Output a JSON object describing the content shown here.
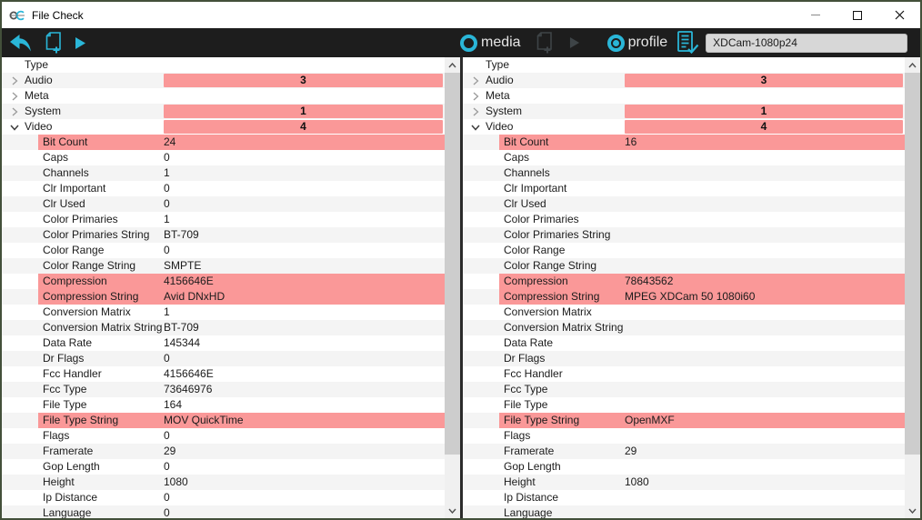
{
  "window": {
    "title": "File Check"
  },
  "toolbar": {
    "media_label": "media",
    "profile_label": "profile",
    "profile_name": "XDCam-1080p24"
  },
  "colors": {
    "accent_teal": "#2ab6d8",
    "highlight_pink": "#fa9898",
    "alt_row": "#f4f4f4",
    "toolbar_bg": "#1d1d1d"
  },
  "tree": {
    "header": "Type",
    "rows": [
      {
        "label": "Audio",
        "indent": 0,
        "expander": "collapsed",
        "left": {
          "badge": "3"
        },
        "right": {
          "badge": "3"
        }
      },
      {
        "label": "Meta",
        "indent": 0,
        "expander": "collapsed",
        "left": {},
        "right": {}
      },
      {
        "label": "System",
        "indent": 0,
        "expander": "collapsed",
        "left": {
          "badge": "1"
        },
        "right": {
          "badge": "1"
        }
      },
      {
        "label": "Video",
        "indent": 0,
        "expander": "expanded",
        "left": {
          "badge": "4"
        },
        "right": {
          "badge": "4"
        }
      },
      {
        "label": "Bit Count",
        "indent": 1,
        "left": {
          "value": "24",
          "highlight": true
        },
        "right": {
          "value": "16",
          "highlight": true
        }
      },
      {
        "label": "Caps",
        "indent": 1,
        "left": {
          "value": "0"
        },
        "right": {}
      },
      {
        "label": "Channels",
        "indent": 1,
        "left": {
          "value": "1"
        },
        "right": {}
      },
      {
        "label": "Clr Important",
        "indent": 1,
        "left": {
          "value": "0"
        },
        "right": {}
      },
      {
        "label": "Clr Used",
        "indent": 1,
        "left": {
          "value": "0"
        },
        "right": {}
      },
      {
        "label": "Color Primaries",
        "indent": 1,
        "left": {
          "value": "1"
        },
        "right": {}
      },
      {
        "label": "Color Primaries String",
        "indent": 1,
        "left": {
          "value": "BT-709"
        },
        "right": {}
      },
      {
        "label": "Color Range",
        "indent": 1,
        "left": {
          "value": "0"
        },
        "right": {}
      },
      {
        "label": "Color Range String",
        "indent": 1,
        "left": {
          "value": "SMPTE"
        },
        "right": {}
      },
      {
        "label": "Compression",
        "indent": 1,
        "left": {
          "value": "4156646E",
          "highlight": true
        },
        "right": {
          "value": "78643562",
          "highlight": true
        }
      },
      {
        "label": "Compression String",
        "indent": 1,
        "left": {
          "value": "Avid DNxHD",
          "highlight": true
        },
        "right": {
          "value": "MPEG XDCam 50 1080i60",
          "highlight": true
        }
      },
      {
        "label": "Conversion Matrix",
        "indent": 1,
        "left": {
          "value": "1"
        },
        "right": {}
      },
      {
        "label": "Conversion Matrix String",
        "indent": 1,
        "left": {
          "value": "BT-709"
        },
        "right": {}
      },
      {
        "label": "Data Rate",
        "indent": 1,
        "left": {
          "value": "145344"
        },
        "right": {}
      },
      {
        "label": "Dr Flags",
        "indent": 1,
        "left": {
          "value": "0"
        },
        "right": {}
      },
      {
        "label": "Fcc Handler",
        "indent": 1,
        "left": {
          "value": "4156646E"
        },
        "right": {}
      },
      {
        "label": "Fcc Type",
        "indent": 1,
        "left": {
          "value": "73646976"
        },
        "right": {}
      },
      {
        "label": "File Type",
        "indent": 1,
        "left": {
          "value": "164"
        },
        "right": {}
      },
      {
        "label": "File Type String",
        "indent": 1,
        "left": {
          "value": "MOV QuickTime",
          "highlight": true
        },
        "right": {
          "value": "OpenMXF",
          "highlight": true
        }
      },
      {
        "label": "Flags",
        "indent": 1,
        "left": {
          "value": "0"
        },
        "right": {}
      },
      {
        "label": "Framerate",
        "indent": 1,
        "left": {
          "value": "29"
        },
        "right": {
          "value": "29"
        }
      },
      {
        "label": "Gop Length",
        "indent": 1,
        "left": {
          "value": "0"
        },
        "right": {}
      },
      {
        "label": "Height",
        "indent": 1,
        "left": {
          "value": "1080"
        },
        "right": {
          "value": "1080"
        }
      },
      {
        "label": "Ip Distance",
        "indent": 1,
        "left": {
          "value": "0"
        },
        "right": {}
      },
      {
        "label": "Language",
        "indent": 1,
        "left": {
          "value": "0"
        },
        "right": {}
      }
    ]
  }
}
